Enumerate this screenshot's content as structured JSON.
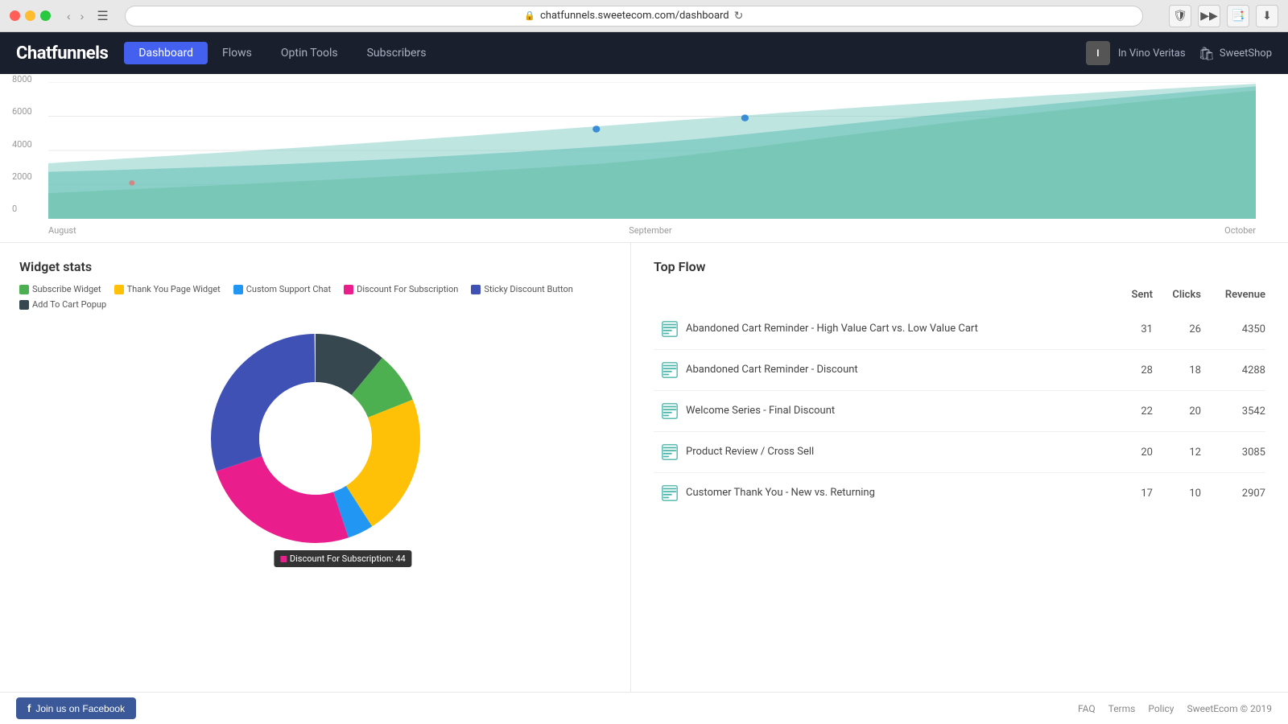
{
  "browser": {
    "url": "chatfunnels.sweetecom.com/dashboard",
    "reload_label": "↻"
  },
  "header": {
    "logo": "Chatfunnels",
    "nav": [
      {
        "id": "dashboard",
        "label": "Dashboard",
        "active": true
      },
      {
        "id": "flows",
        "label": "Flows",
        "active": false
      },
      {
        "id": "optin-tools",
        "label": "Optin Tools",
        "active": false
      },
      {
        "id": "subscribers",
        "label": "Subscribers",
        "active": false
      }
    ],
    "user": {
      "initials": "I",
      "name": "In Vino Veritas"
    },
    "shop": {
      "name": "SweetShop"
    }
  },
  "chart": {
    "y_labels": [
      "0",
      "2000",
      "4000",
      "6000",
      "8000"
    ],
    "x_labels": [
      "August",
      "September",
      "October"
    ]
  },
  "widget_stats": {
    "title": "Widget stats",
    "legend": [
      {
        "label": "Subscribe Widget",
        "color": "#4CAF50"
      },
      {
        "label": "Thank You Page Widget",
        "color": "#FFC107"
      },
      {
        "label": "Custom Support Chat",
        "color": "#2196F3"
      },
      {
        "label": "Discount For Subscription",
        "color": "#e91e8c"
      },
      {
        "label": "Sticky Discount Button",
        "color": "#3f51b5"
      },
      {
        "label": "Add To Cart Popup",
        "color": "#37474f"
      }
    ],
    "donut_segments": [
      {
        "label": "Subscribe Widget",
        "color": "#4CAF50",
        "percent": 8
      },
      {
        "label": "Thank You Page Widget",
        "color": "#FFC107",
        "percent": 22
      },
      {
        "label": "Custom Support Chat",
        "color": "#2196F3",
        "percent": 4
      },
      {
        "label": "Discount For Subscription",
        "color": "#e91e8c",
        "percent": 25
      },
      {
        "label": "Sticky Discount Button",
        "color": "#3f51b5",
        "percent": 30
      },
      {
        "label": "Add To Cart Popup",
        "color": "#37474f",
        "percent": 11
      }
    ],
    "tooltip": "Discount For Subscription: 44"
  },
  "top_flow": {
    "title": "Top Flow",
    "headers": {
      "name": "",
      "sent": "Sent",
      "clicks": "Clicks",
      "revenue": "Revenue"
    },
    "rows": [
      {
        "name": "Abandoned Cart Reminder - High Value Cart vs. Low Value Cart",
        "sent": 31,
        "clicks": 26,
        "revenue": 4350
      },
      {
        "name": "Abandoned Cart Reminder - Discount",
        "sent": 28,
        "clicks": 18,
        "revenue": 4288
      },
      {
        "name": "Welcome Series - Final Discount",
        "sent": 22,
        "clicks": 20,
        "revenue": 3542
      },
      {
        "name": "Product Review / Cross Sell",
        "sent": 20,
        "clicks": 12,
        "revenue": 3085
      },
      {
        "name": "Customer Thank You - New vs. Returning",
        "sent": 17,
        "clicks": 10,
        "revenue": 2907
      }
    ]
  },
  "footer": {
    "facebook_btn": "Join us on Facebook",
    "links": [
      "FAQ",
      "Terms",
      "Policy",
      "SweetEcom © 2019"
    ]
  }
}
